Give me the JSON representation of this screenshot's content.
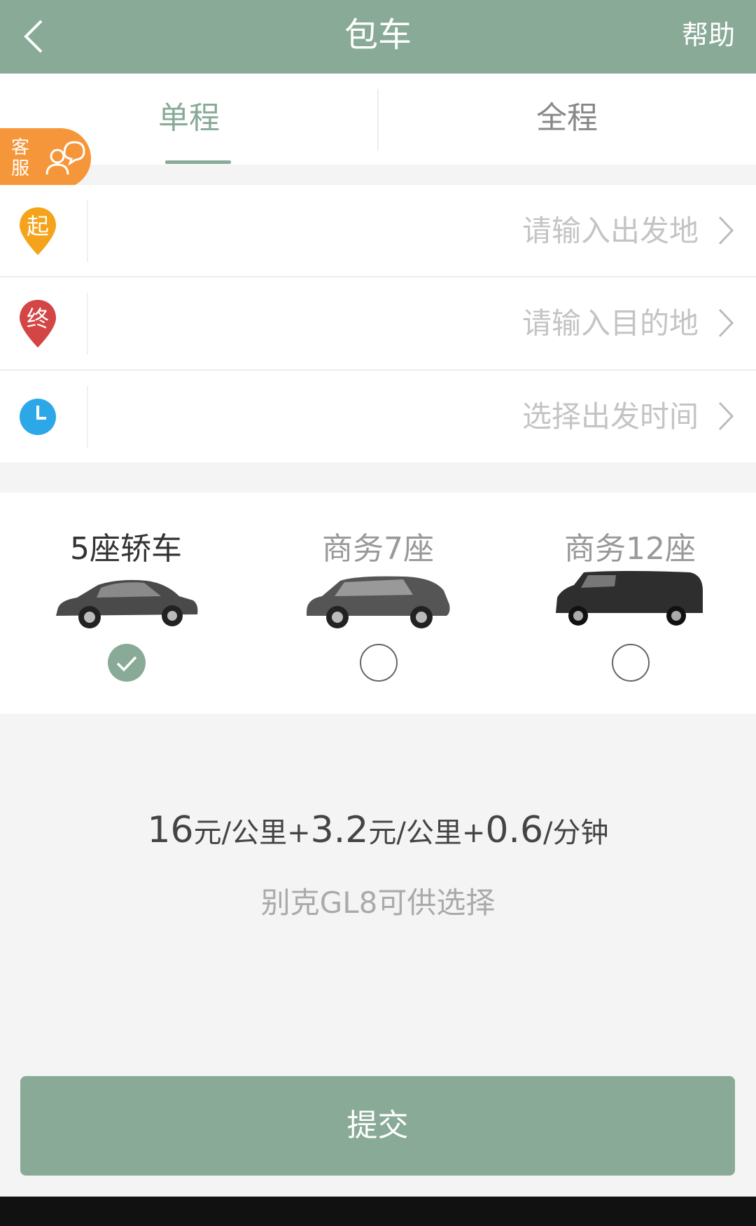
{
  "header": {
    "title": "包车",
    "help_label": "帮助",
    "back_icon": "back-arrow-icon"
  },
  "tabs": [
    {
      "label": "单程",
      "active": true
    },
    {
      "label": "全程",
      "active": false
    }
  ],
  "service_badge": {
    "label_line1": "客",
    "label_line2": "服",
    "icon": "customer-service-icon",
    "color": "#f6963a"
  },
  "form": {
    "start": {
      "pin_label": "起",
      "placeholder": "请输入出发地",
      "color": "#f5a31a"
    },
    "end": {
      "pin_label": "终",
      "placeholder": "请输入目的地",
      "color": "#d44545"
    },
    "time": {
      "placeholder": "选择出发时间",
      "color": "#2ca8e8"
    }
  },
  "vehicles": [
    {
      "name": "5座轿车",
      "selected": true
    },
    {
      "name": "商务7座",
      "selected": false
    },
    {
      "name": "商务12座",
      "selected": false
    }
  ],
  "pricing": {
    "part1_num": "16",
    "part1_unit": "元/公里",
    "plus": "+",
    "part2_num": "3.2",
    "part2_unit": "元/公里",
    "part3_num": "0.6",
    "part3_unit": "/分钟",
    "note": "别克GL8可供选择"
  },
  "submit_label": "提交",
  "colors": {
    "primary": "#88aa97",
    "badge": "#f6963a"
  }
}
